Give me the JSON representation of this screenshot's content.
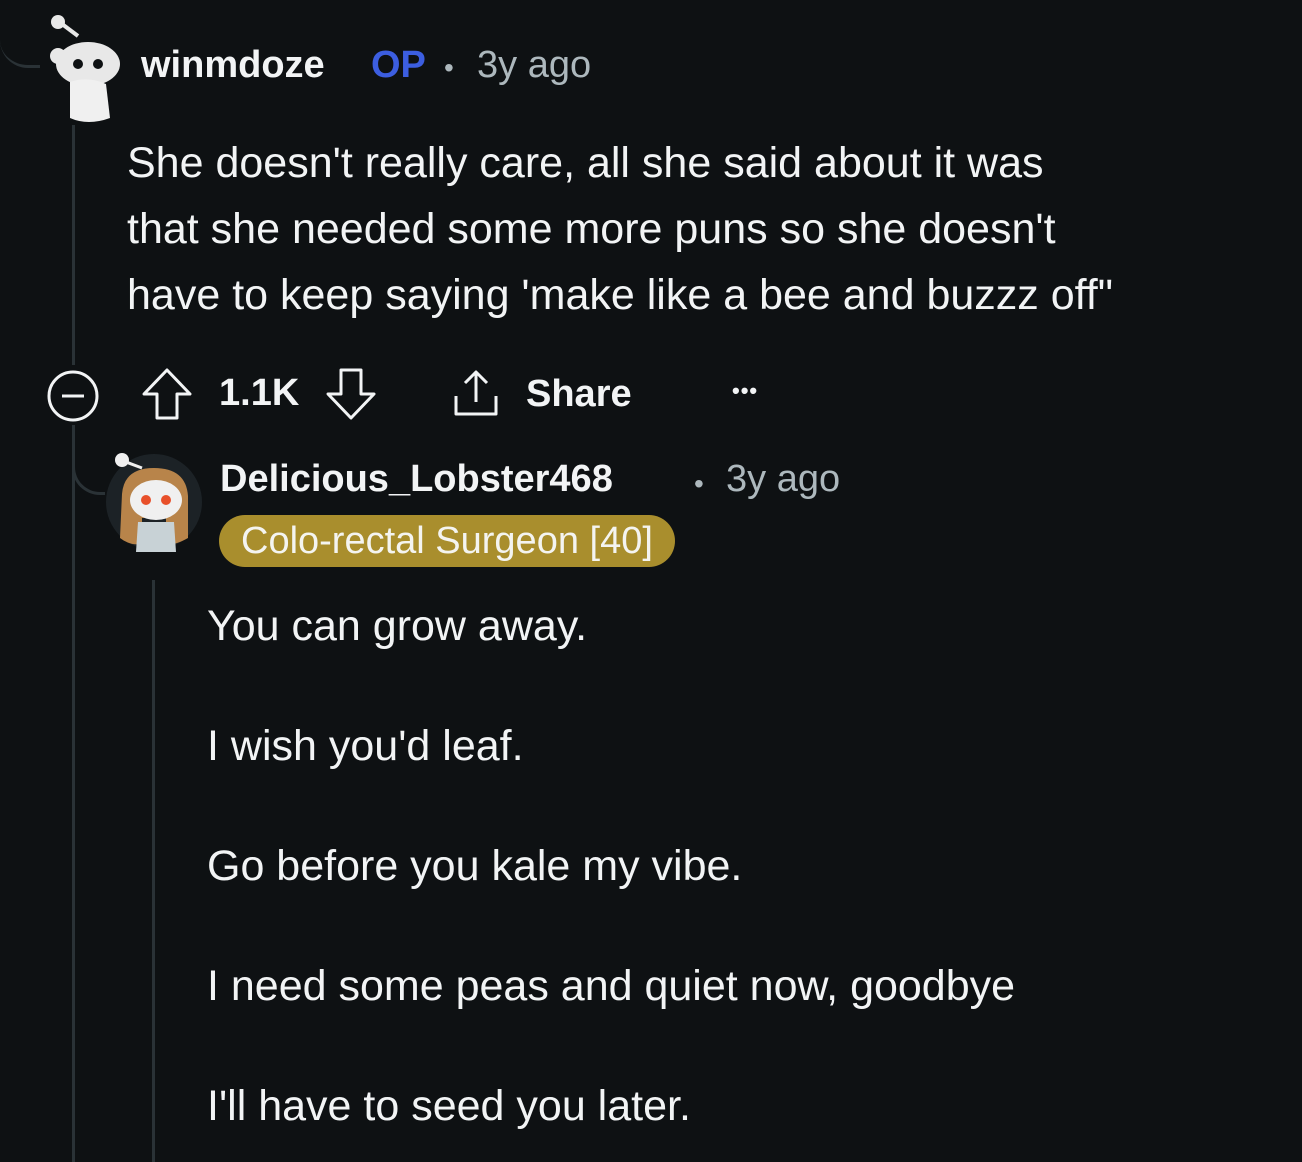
{
  "comment": {
    "author": "winmdoze",
    "op_badge": "OP",
    "separator": "•",
    "timestamp": "3y ago",
    "body_lines": [
      "She doesn't really care, all she said about it was",
      "that she needed some more puns so she doesn't",
      "have to keep saying 'make like a bee and buzzz off\""
    ],
    "actions": {
      "vote_count": "1.1K",
      "share_label": "Share",
      "more_label": "•••"
    },
    "icons": {
      "collapse": "collapse-minus-icon",
      "upvote": "upvote-arrow-icon",
      "downvote": "downvote-arrow-icon",
      "share": "share-upload-icon",
      "more": "more-options-icon"
    }
  },
  "reply": {
    "author": "Delicious_Lobster468",
    "separator": "•",
    "timestamp": "3y ago",
    "flair": "Colo-rectal Surgeon [40]",
    "body_paragraphs": [
      "You can grow away.",
      "I wish you'd leaf.",
      "Go before you kale my vibe.",
      "I need some peas and quiet now, goodbye",
      "I'll have to seed you later."
    ]
  },
  "colors": {
    "background": "#0e1113",
    "text": "#f2f4f5",
    "muted": "#adb8bd",
    "op_blue": "#3c5ee0",
    "flair_gold": "#a98e2d",
    "thread_line": "#2a3236"
  }
}
